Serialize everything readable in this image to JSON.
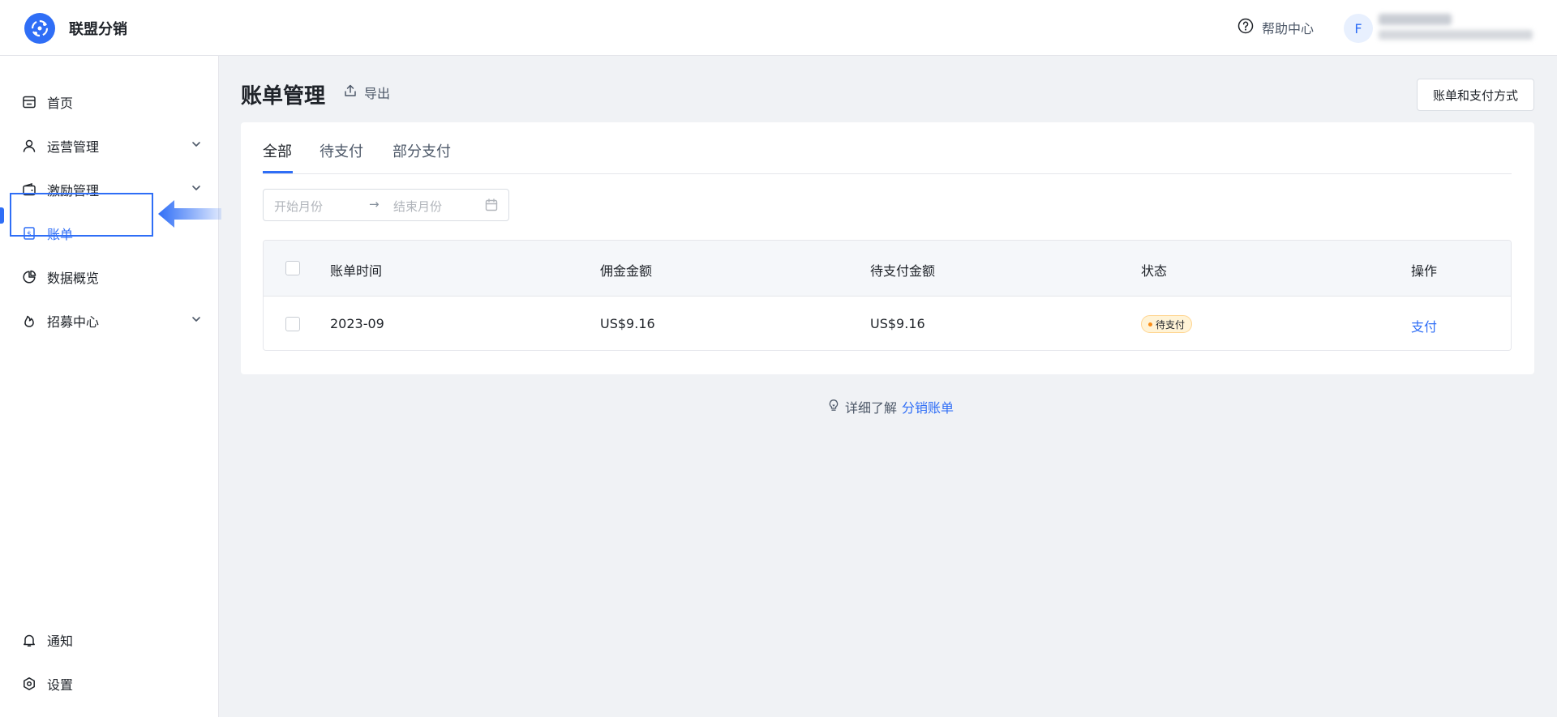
{
  "app": {
    "title": "联盟分销"
  },
  "header": {
    "help_label": "帮助中心",
    "avatar_letter": "F"
  },
  "sidebar": {
    "items": [
      {
        "label": "首页",
        "icon": "storefront-icon",
        "expandable": false
      },
      {
        "label": "运营管理",
        "icon": "user-icon",
        "expandable": true
      },
      {
        "label": "激励管理",
        "icon": "wallet-icon",
        "expandable": true
      },
      {
        "label": "账单",
        "icon": "bill-icon",
        "expandable": false,
        "active": true
      },
      {
        "label": "数据概览",
        "icon": "pie-chart-icon",
        "expandable": false
      },
      {
        "label": "招募中心",
        "icon": "flame-icon",
        "expandable": true
      }
    ],
    "bottom_items": [
      {
        "label": "通知",
        "icon": "bell-icon"
      },
      {
        "label": "设置",
        "icon": "settings-icon"
      }
    ]
  },
  "main": {
    "page_title": "账单管理",
    "export_label": "导出",
    "bill_pay_button": "账单和支付方式",
    "tabs": [
      {
        "label": "全部",
        "active": true
      },
      {
        "label": "待支付",
        "active": false
      },
      {
        "label": "部分支付",
        "active": false
      }
    ],
    "date_range": {
      "start_placeholder": "开始月份",
      "separator": "→",
      "end_placeholder": "结束月份"
    },
    "table": {
      "columns": [
        "账单时间",
        "佣金金额",
        "待支付金额",
        "状态",
        "操作"
      ],
      "rows": [
        {
          "time": "2023-09",
          "commission": "US$9.16",
          "pending": "US$9.16",
          "status": "待支付",
          "action": "支付"
        }
      ]
    },
    "learn_more": {
      "prefix": "详细了解",
      "link": "分销账单"
    }
  },
  "colors": {
    "accent": "#2f6ef6",
    "status_pending_bg": "#fff3d6",
    "status_pending_dot": "#fa8c16"
  }
}
